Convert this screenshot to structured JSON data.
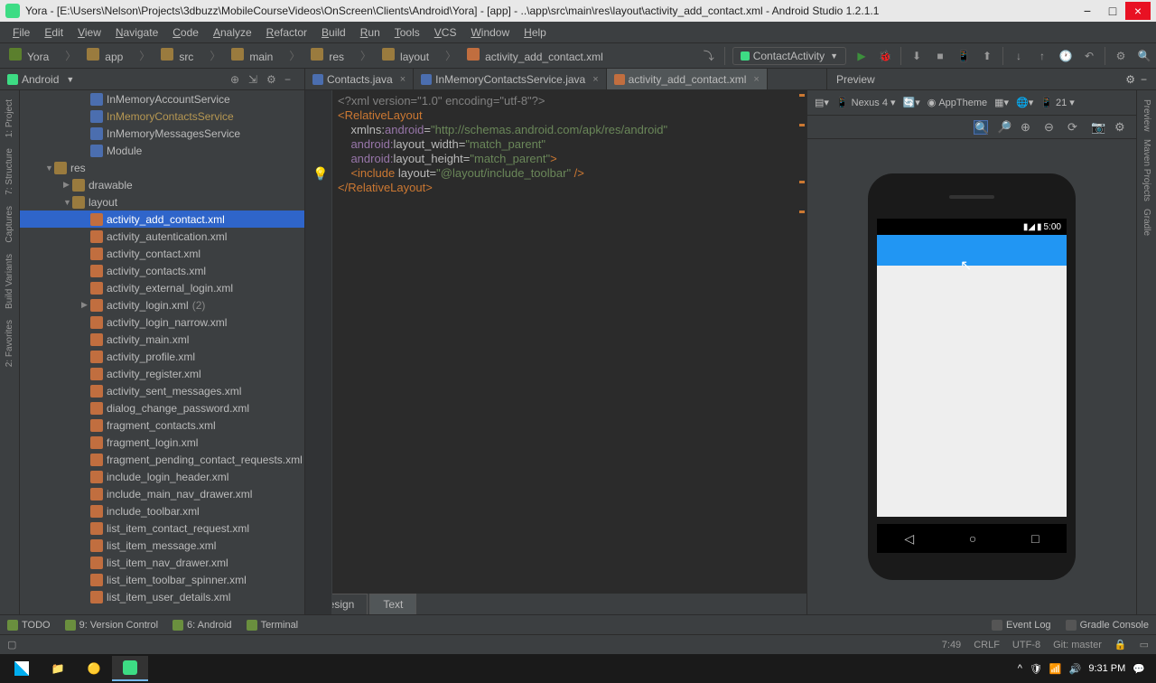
{
  "titlebar": {
    "text": "Yora - [E:\\Users\\Nelson\\Projects\\3dbuzz\\MobileCourseVideos\\OnScreen\\Clients\\Android\\Yora] - [app] - ..\\app\\src\\main\\res\\layout\\activity_add_contact.xml - Android Studio 1.2.1.1"
  },
  "menu": [
    "File",
    "Edit",
    "View",
    "Navigate",
    "Code",
    "Analyze",
    "Refactor",
    "Build",
    "Run",
    "Tools",
    "VCS",
    "Window",
    "Help"
  ],
  "breadcrumb": [
    "Yora",
    "app",
    "src",
    "main",
    "res",
    "layout",
    "activity_add_contact.xml"
  ],
  "run_config": "ContactActivity",
  "project_dropdown": "Android",
  "editor_tabs": [
    {
      "name": "Contacts.java",
      "type": "java",
      "active": false
    },
    {
      "name": "InMemoryContactsService.java",
      "type": "java",
      "active": false
    },
    {
      "name": "activity_add_contact.xml",
      "type": "xml",
      "active": true
    }
  ],
  "preview_label": "Preview",
  "tree": [
    {
      "label": "InMemoryAccountService",
      "icon": "class",
      "indent": 3
    },
    {
      "label": "InMemoryContactsService",
      "icon": "class",
      "indent": 3,
      "highlighted": true
    },
    {
      "label": "InMemoryMessagesService",
      "icon": "class",
      "indent": 3
    },
    {
      "label": "Module",
      "icon": "class",
      "indent": 3
    },
    {
      "label": "res",
      "icon": "folder",
      "indent": 1,
      "arrow": "▼"
    },
    {
      "label": "drawable",
      "icon": "folder",
      "indent": 2,
      "arrow": "▶"
    },
    {
      "label": "layout",
      "icon": "folder",
      "indent": 2,
      "arrow": "▼"
    },
    {
      "label": "activity_add_contact.xml",
      "icon": "xml",
      "indent": 3,
      "selected": true
    },
    {
      "label": "activity_autentication.xml",
      "icon": "xml",
      "indent": 3
    },
    {
      "label": "activity_contact.xml",
      "icon": "xml",
      "indent": 3
    },
    {
      "label": "activity_contacts.xml",
      "icon": "xml",
      "indent": 3
    },
    {
      "label": "activity_external_login.xml",
      "icon": "xml",
      "indent": 3
    },
    {
      "label": "activity_login.xml",
      "icon": "xml",
      "indent": 3,
      "count": "(2)",
      "arrow": "▶"
    },
    {
      "label": "activity_login_narrow.xml",
      "icon": "xml",
      "indent": 3
    },
    {
      "label": "activity_main.xml",
      "icon": "xml",
      "indent": 3
    },
    {
      "label": "activity_profile.xml",
      "icon": "xml",
      "indent": 3
    },
    {
      "label": "activity_register.xml",
      "icon": "xml",
      "indent": 3
    },
    {
      "label": "activity_sent_messages.xml",
      "icon": "xml",
      "indent": 3
    },
    {
      "label": "dialog_change_password.xml",
      "icon": "xml",
      "indent": 3
    },
    {
      "label": "fragment_contacts.xml",
      "icon": "xml",
      "indent": 3
    },
    {
      "label": "fragment_login.xml",
      "icon": "xml",
      "indent": 3
    },
    {
      "label": "fragment_pending_contact_requests.xml",
      "icon": "xml",
      "indent": 3
    },
    {
      "label": "include_login_header.xml",
      "icon": "xml",
      "indent": 3
    },
    {
      "label": "include_main_nav_drawer.xml",
      "icon": "xml",
      "indent": 3
    },
    {
      "label": "include_toolbar.xml",
      "icon": "xml",
      "indent": 3
    },
    {
      "label": "list_item_contact_request.xml",
      "icon": "xml",
      "indent": 3
    },
    {
      "label": "list_item_message.xml",
      "icon": "xml",
      "indent": 3
    },
    {
      "label": "list_item_nav_drawer.xml",
      "icon": "xml",
      "indent": 3
    },
    {
      "label": "list_item_toolbar_spinner.xml",
      "icon": "xml",
      "indent": 3
    },
    {
      "label": "list_item_user_details.xml",
      "icon": "xml",
      "indent": 3
    }
  ],
  "code_lines": [
    {
      "segs": [
        {
          "t": "<?xml version=\"1.0\" encoding=\"utf-8\"?>",
          "c": "decl"
        }
      ]
    },
    {
      "segs": [
        {
          "t": "<RelativeLayout",
          "c": "tag"
        }
      ]
    },
    {
      "segs": [
        {
          "t": "    ",
          "c": ""
        },
        {
          "t": "xmlns:",
          "c": "ns"
        },
        {
          "t": "android",
          "c": "attr"
        },
        {
          "t": "=",
          "c": "ns"
        },
        {
          "t": "\"http://schemas.android.com/apk/res/android\"",
          "c": "str"
        }
      ]
    },
    {
      "segs": [
        {
          "t": "    ",
          "c": ""
        },
        {
          "t": "android:",
          "c": "attr"
        },
        {
          "t": "layout_width=",
          "c": "ns"
        },
        {
          "t": "\"match_parent\"",
          "c": "str"
        }
      ]
    },
    {
      "segs": [
        {
          "t": "    ",
          "c": ""
        },
        {
          "t": "android:",
          "c": "attr"
        },
        {
          "t": "layout_height=",
          "c": "ns"
        },
        {
          "t": "\"match_parent\"",
          "c": "str"
        },
        {
          "t": ">",
          "c": "tag"
        }
      ]
    },
    {
      "segs": [
        {
          "t": "",
          "c": ""
        }
      ]
    },
    {
      "segs": [
        {
          "t": "    ",
          "c": ""
        },
        {
          "t": "<include ",
          "c": "tag"
        },
        {
          "t": "layout=",
          "c": "ns"
        },
        {
          "t": "\"@layout/include_toolbar\"",
          "c": "str"
        },
        {
          "t": " />",
          "c": "tag"
        }
      ]
    },
    {
      "segs": [
        {
          "t": "",
          "c": ""
        }
      ]
    },
    {
      "segs": [
        {
          "t": "</RelativeLayout>",
          "c": "tag"
        }
      ]
    }
  ],
  "design_tabs": {
    "design": "Design",
    "text": "Text"
  },
  "preview_tools": {
    "device": "Nexus 4",
    "theme": "AppTheme",
    "api": "21"
  },
  "phone": {
    "time": "5:00"
  },
  "left_rail": [
    "1: Project",
    "7: Structure",
    "Captures",
    "Build Variants",
    "2: Favorites"
  ],
  "right_rail": [
    "Preview",
    "Maven Projects",
    "Gradle"
  ],
  "bottom_tabs": {
    "left": [
      "TODO",
      "9: Version Control",
      "6: Android",
      "Terminal"
    ],
    "right": [
      "Event Log",
      "Gradle Console"
    ]
  },
  "statusbar": {
    "pos": "7:49",
    "crlf": "CRLF",
    "enc": "UTF-8",
    "git": "Git: master",
    "lock": "🔒"
  },
  "taskbar": {
    "time": "9:31 PM"
  }
}
